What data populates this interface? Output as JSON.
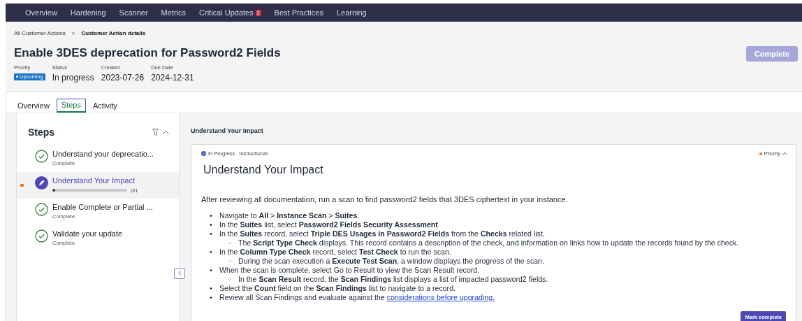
{
  "nav": [
    {
      "label": "Overview"
    },
    {
      "label": "Hardening"
    },
    {
      "label": "Scanner"
    },
    {
      "label": "Metrics"
    },
    {
      "label": "Critical Updates",
      "badge": "2"
    },
    {
      "label": "Best Practices"
    },
    {
      "label": "Learning"
    }
  ],
  "breadcrumb": [
    {
      "label": "All Customer Actions",
      "kind": "link"
    },
    {
      "label": "Customer Action details",
      "kind": "current"
    }
  ],
  "separator": ">",
  "title": "Enable 3DES deprecation for Password2 Fields",
  "complete_button": {
    "label": "Complete",
    "disabled": true
  },
  "meta": [
    {
      "label": "Priority",
      "value": "Upcoming",
      "kind": "badge"
    },
    {
      "label": "Status",
      "value": "In progress",
      "kind": "text"
    },
    {
      "label": "Created",
      "value": "2023-07-26",
      "kind": "text"
    },
    {
      "label": "Due Date",
      "value": "2024-12-31",
      "kind": "text"
    }
  ],
  "tabs": [
    {
      "label": "Overview",
      "selected": false
    },
    {
      "label": "Steps",
      "selected": true
    },
    {
      "label": "Activity",
      "selected": false
    }
  ],
  "steps_panel": {
    "title": "Steps",
    "items": [
      {
        "title": "Understand your deprecatio...",
        "kind": "complete",
        "subtitle": "Complete",
        "selected": false
      },
      {
        "title": "Understand Your Impact",
        "kind": "current",
        "level": 0,
        "progress": "0/1",
        "selected": true
      },
      {
        "title": "Enable Complete or Partial ...",
        "kind": "complete",
        "subtitle": "Complete",
        "selected": false
      },
      {
        "title": "Validate your update",
        "kind": "complete",
        "subtitle": "Complete",
        "selected": false
      }
    ]
  },
  "detail": {
    "heading": "Understand Your Impact",
    "status": "In Progress",
    "type": "Instructional",
    "priority": "Priority",
    "title": "Understand Your Impact",
    "intro": "After reviewing all documentation, run a scan to find password2 fields that 3DES ciphertext in your instance.",
    "bullets": [
      {
        "text": "Navigate to **All** > **Instance Scan** > **Suites**."
      },
      {
        "text": "In the **Suites** list, select **Password2 Fields Security Assessment**"
      },
      {
        "text": "In the **Suites** record, select **Triple DES Usages in Password2 Fields** from the **Checks** related list.",
        "children": [
          {
            "text": "The **Script Type Check** displays. This record contains a description of the check, and information on links how to update the records found by the check."
          }
        ]
      },
      {
        "text": "In the **Column Type Check** record, select **Test Check** to run the scan.",
        "children": [
          {
            "text": "During the scan execution a **Execute Test Scan**, a window displays the progress of the scan."
          }
        ]
      },
      {
        "text": "When the scan is complete, select Go to Result to view the Scan Result record.",
        "children": [
          {
            "text": "In the **Scan Result** record, the **Scan Findings** list displays a list of impacted password2 fields."
          }
        ]
      },
      {
        "text": "Select the **Count** field on the **Scan Findings** list to navigate to a record."
      },
      {
        "text": "Review all Scan Findings and evaluate against the ",
        "link": "considerations before upgrading."
      }
    ],
    "bullet": "•",
    "sub_bullet": "◦",
    "mark_button": "Mark complete"
  }
}
